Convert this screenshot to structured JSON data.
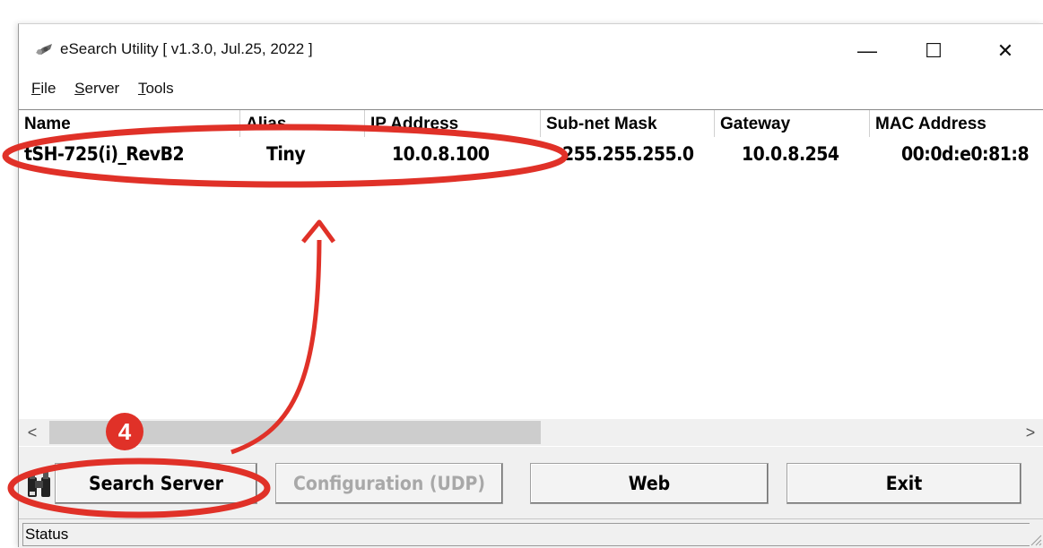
{
  "window": {
    "title": "eSearch Utility [ v1.3.0, Jul.25, 2022 ]",
    "minimize_glyph": "—",
    "maximize_glyph": "☐",
    "close_glyph": "✕"
  },
  "menu": [
    {
      "label": "File",
      "accel": "F",
      "rest": "ile"
    },
    {
      "label": "Server",
      "accel": "S",
      "rest": "erver"
    },
    {
      "label": "Tools",
      "accel": "T",
      "rest": "ools"
    }
  ],
  "table": {
    "columns": [
      "Name",
      "Alias",
      "IP Address",
      "Sub-net Mask",
      "Gateway",
      "MAC Address"
    ],
    "rows": [
      [
        "tSH-725(i)_RevB2",
        "Tiny",
        "10.0.8.100",
        "255.255.255.0",
        "10.0.8.254",
        "00:0d:e0:81:8"
      ]
    ]
  },
  "scrollbar": {
    "left_arrow": "<",
    "right_arrow": ">"
  },
  "buttons": {
    "search": "Search Server",
    "configuration": "Configuration (UDP)",
    "web": "Web",
    "exit": "Exit"
  },
  "status": {
    "label": "Status"
  },
  "annotation": {
    "step_number": "4",
    "color": "#e03128"
  }
}
